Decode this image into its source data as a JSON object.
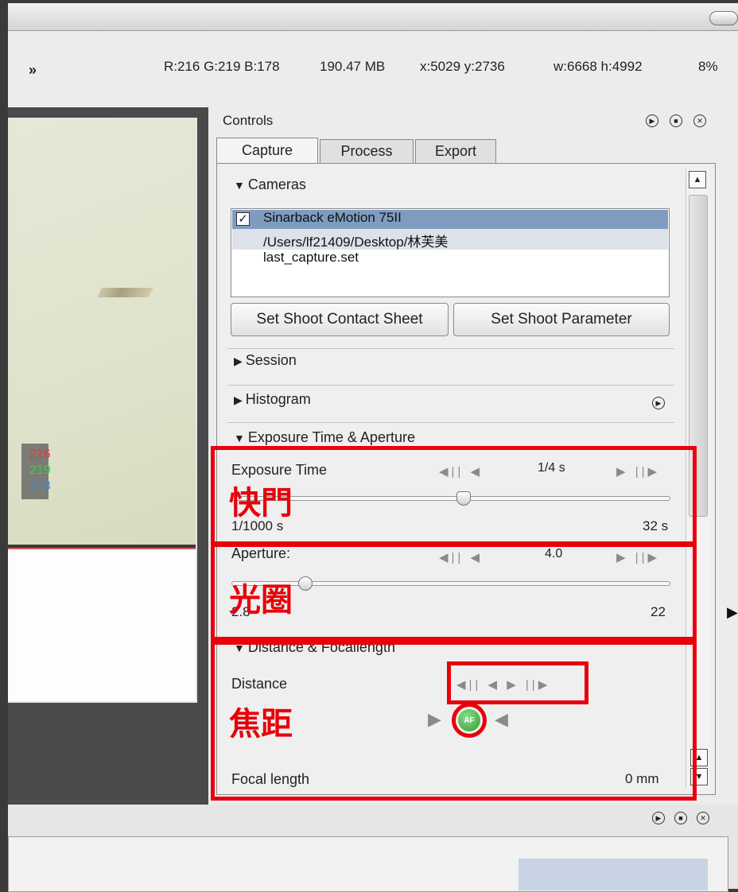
{
  "infobar": {
    "expand": "»",
    "rgb": "R:216 G:219 B:178",
    "size": "190.47 MB",
    "coords": "x:5029 y:2736",
    "dims": "w:6668 h:4992",
    "zoom": "8%"
  },
  "viewer": {
    "readout_r": "216",
    "readout_g": "219",
    "readout_b": "178"
  },
  "controls": {
    "title": "Controls",
    "tabs": [
      "Capture",
      "Process",
      "Export"
    ],
    "cameras": {
      "header": "Cameras",
      "items": [
        "Sinarback eMotion 75II",
        "/Users/lf21409/Desktop/林芙美",
        "last_capture.set"
      ]
    },
    "buttons": {
      "contact_sheet": "Set Shoot Contact Sheet",
      "parameter": "Set Shoot Parameter"
    },
    "session": "Session",
    "histogram": "Histogram",
    "exposure_section": "Exposure Time & Aperture",
    "exposure": {
      "label": "Exposure Time",
      "value": "1/4 s",
      "min": "1/1000 s",
      "max": "32 s"
    },
    "aperture": {
      "label": "Aperture:",
      "value": "4.0",
      "min": "2.8",
      "max": "22"
    },
    "distance_section": "Distance & Focallength",
    "distance_label": "Distance",
    "af": "AF",
    "focal_label": "Focal length",
    "focal_value": "0 mm"
  },
  "annotations": {
    "shutter": "快門",
    "aperture": "光圈",
    "focus": "焦距"
  },
  "colors": {
    "annotation_red": "#e8000b",
    "readout_r": "#e8383a",
    "readout_g": "#3ccf3c",
    "readout_b": "#3a8fd6",
    "selection_blue": "#7f9cc0"
  }
}
